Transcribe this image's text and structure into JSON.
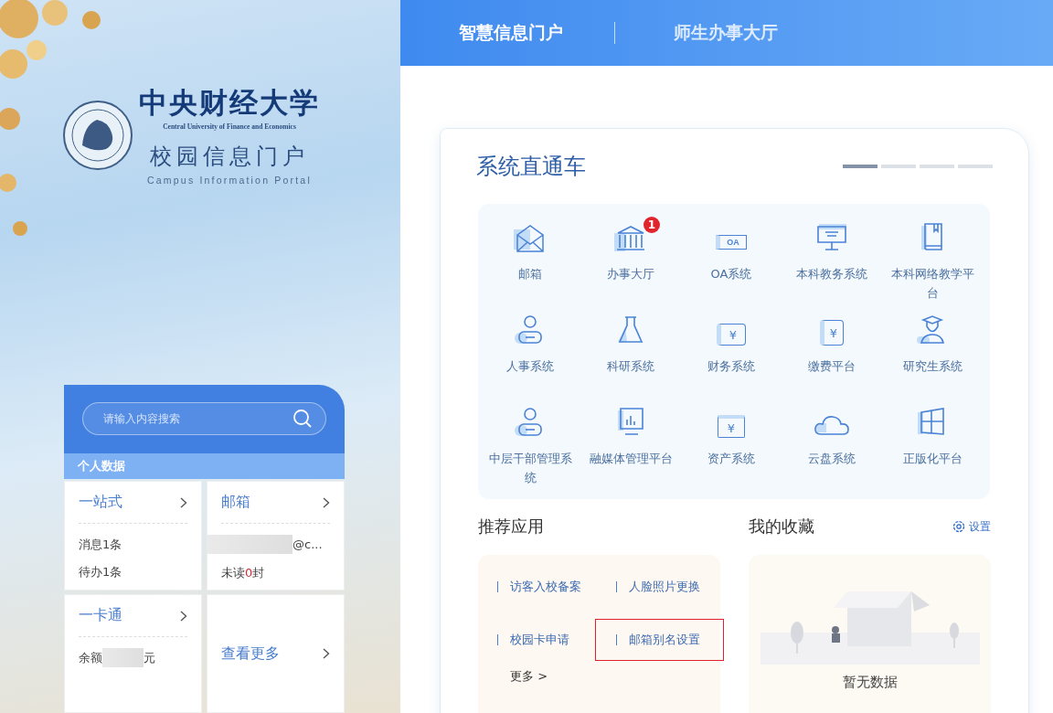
{
  "logo": {
    "name": "中央财经大学",
    "name_en": "Central University of Finance and Economics",
    "portal": "校园信息门户",
    "portal_en": "Campus Information Portal"
  },
  "search": {
    "placeholder": "请输入内容搜索"
  },
  "personal": {
    "title": "个人数据",
    "cards": [
      {
        "kind": "stats",
        "title": "一站式",
        "lines": [
          "消息1条",
          "待办1条"
        ]
      },
      {
        "kind": "mail",
        "title": "邮箱",
        "email": "@c...",
        "unread_prefix": "未读",
        "unread_count": "0",
        "unread_suffix": "封"
      },
      {
        "kind": "balance",
        "title": "一卡通",
        "prefix": "余额",
        "suffix": "元"
      },
      {
        "kind": "more",
        "title": "查看更多"
      }
    ]
  },
  "tabs": [
    {
      "label": "智慧信息门户",
      "selected": true
    },
    {
      "label": "师生办事大厅",
      "selected": false
    }
  ],
  "systems": {
    "title": "系统直通车",
    "pages": [
      {
        "selected": true
      },
      {
        "selected": false
      },
      {
        "selected": false
      },
      {
        "selected": false
      }
    ],
    "items": [
      {
        "kind": "mail",
        "label": "邮箱"
      },
      {
        "kind": "hall",
        "label": "办事大厅",
        "badge": "1"
      },
      {
        "kind": "oa",
        "label": "OA系统",
        "icon_text": "OA"
      },
      {
        "kind": "monitor",
        "label": "本科教务系统"
      },
      {
        "kind": "book",
        "label": "本科网络教学平台"
      },
      {
        "kind": "person",
        "label": "人事系统"
      },
      {
        "kind": "flask",
        "label": "科研系统"
      },
      {
        "kind": "money",
        "label": "财务系统",
        "icon_text": "¥"
      },
      {
        "kind": "phone",
        "label": "缴费平台",
        "icon_text": "¥"
      },
      {
        "kind": "graduate",
        "label": "研究生系统"
      },
      {
        "kind": "person",
        "label": "中层干部管理系统"
      },
      {
        "kind": "chart",
        "label": "融媒体管理平台"
      },
      {
        "kind": "ticket",
        "label": "资产系统",
        "icon_text": "¥"
      },
      {
        "kind": "cloud",
        "label": "云盘系统"
      },
      {
        "kind": "windows",
        "label": "正版化平台"
      }
    ]
  },
  "recommended": {
    "title": "推荐应用",
    "items": [
      {
        "label": "访客入校备案",
        "highlighted": false
      },
      {
        "label": "人脸照片更换",
        "highlighted": false
      },
      {
        "label": "校园卡申请",
        "highlighted": false
      },
      {
        "label": "邮箱别名设置",
        "highlighted": true
      }
    ],
    "more": "更多 >"
  },
  "favorites": {
    "title": "我的收藏",
    "settings": "设置",
    "empty": "暂无数据"
  }
}
